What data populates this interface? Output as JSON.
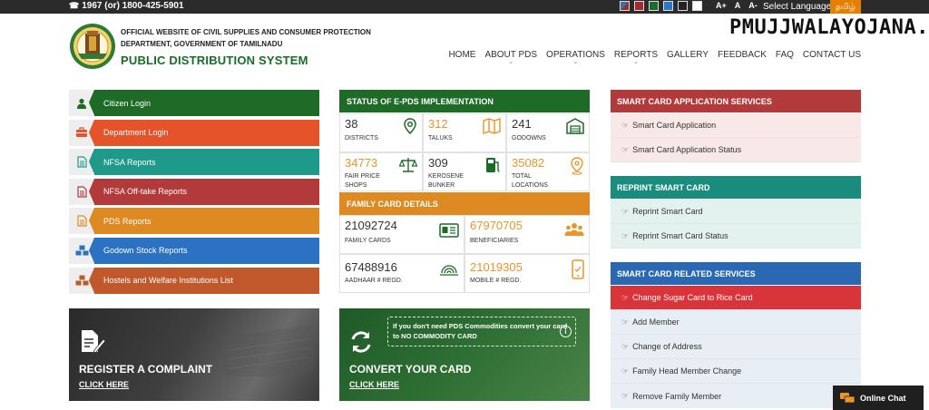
{
  "topbar": {
    "phone": "1967 (or) 1800-425-5901",
    "swatch_colors": [
      "#3c6ea8",
      "#a5282c",
      "#1b6b2a",
      "#2a79c9",
      "#222222",
      "#ffffff"
    ],
    "font_sizes": [
      "A+",
      "A",
      "A-"
    ],
    "select_language": "Select Language",
    "tamil": "தமிழ்"
  },
  "watermark": "PMUJJWALAYOJANA.IN",
  "header": {
    "line1": "OFFICIAL WEBSITE OF CIVIL SUPPLIES AND CONSUMER PROTECTION",
    "line2": "DEPARTMENT, GOVERNMENT OF TAMILNADU",
    "title": "PUBLIC DISTRIBUTION SYSTEM"
  },
  "nav": [
    {
      "label": "HOME",
      "dropdown": false
    },
    {
      "label": "ABOUT PDS",
      "dropdown": true
    },
    {
      "label": "OPERATIONS",
      "dropdown": true
    },
    {
      "label": "REPORTS",
      "dropdown": true
    },
    {
      "label": "GALLERY",
      "dropdown": false
    },
    {
      "label": "FEEDBACK",
      "dropdown": false
    },
    {
      "label": "FAQ",
      "dropdown": false
    },
    {
      "label": "CONTACT US",
      "dropdown": false
    }
  ],
  "menu": [
    {
      "label": "Citizen Login",
      "color": "#1e6b27",
      "icon": "user-icon"
    },
    {
      "label": "Department Login",
      "color": "#e4532a",
      "icon": "briefcase-icon"
    },
    {
      "label": "NFSA Reports",
      "color": "#1f9a8a",
      "icon": "document-icon"
    },
    {
      "label": "NFSA Off-take Reports",
      "color": "#b33a3a",
      "icon": "document-icon"
    },
    {
      "label": "PDS Reports",
      "color": "#de8a22",
      "icon": "document-icon"
    },
    {
      "label": "Godown Stock Reports",
      "color": "#2b72c2",
      "icon": "cubes-icon"
    },
    {
      "label": "Hostels and Welfare Institutions List",
      "color": "#c1582c",
      "icon": "cubes-icon"
    }
  ],
  "epds": {
    "title": "STATUS OF E-PDS IMPLEMENTATION",
    "stats": [
      {
        "value": "38",
        "label": "DISTRICTS",
        "color": "#333333",
        "icon": "location-icon"
      },
      {
        "value": "312",
        "label": "TALUKS",
        "color": "#e8952b",
        "icon": "map-icon"
      },
      {
        "value": "241",
        "label": "GODOWNS",
        "color": "#333333",
        "icon": "warehouse-icon"
      },
      {
        "value": "34773",
        "label": "FAIR PRICE\nSHOPS",
        "color": "#e8952b",
        "icon": "scale-icon"
      },
      {
        "value": "309",
        "label": "KEROSENE\nBUNKER",
        "color": "#333333",
        "icon": "fuel-icon"
      },
      {
        "value": "35082",
        "label": "TOTAL\nLOCATIONS",
        "color": "#e8952b",
        "icon": "pin-icon"
      }
    ]
  },
  "family": {
    "title": "FAMILY CARD DETAILS",
    "stats": [
      {
        "value": "21092724",
        "label": "FAMILY CARDS",
        "color": "#333333",
        "icon": "id-card-icon"
      },
      {
        "value": "67970705",
        "label": "BENEFICIARIES",
        "color": "#e8952b",
        "icon": "group-icon"
      },
      {
        "value": "67488916",
        "label": "AADHAAR # REGD.",
        "color": "#333333",
        "icon": "aadhaar-icon"
      },
      {
        "value": "21019305",
        "label": "MOBILE # REGD.",
        "color": "#e8952b",
        "icon": "mobile-icon"
      }
    ]
  },
  "banners": {
    "complaint": {
      "title": "REGISTER A COMPLAINT",
      "link": "CLICK HERE"
    },
    "convert": {
      "title": "CONVERT YOUR CARD",
      "link": "CLICK HERE",
      "notice": "If you don't need PDS Commodities convert your card to NO COMMODITY CARD"
    }
  },
  "right": {
    "app_services": {
      "title": "SMART CARD APPLICATION SERVICES",
      "links": [
        "Smart Card Application",
        "Smart Card Application Status"
      ]
    },
    "reprint": {
      "title": "REPRINT SMART CARD",
      "links": [
        "Reprint Smart Card",
        "Reprint Smart Card Status"
      ]
    },
    "related": {
      "title": "SMART CARD RELATED SERVICES",
      "links": [
        "Change Sugar Card to Rice Card",
        "Add Member",
        "Change of Address",
        "Family Head Member Change",
        "Remove Family Member"
      ]
    }
  },
  "chat": {
    "label": "Online Chat"
  }
}
